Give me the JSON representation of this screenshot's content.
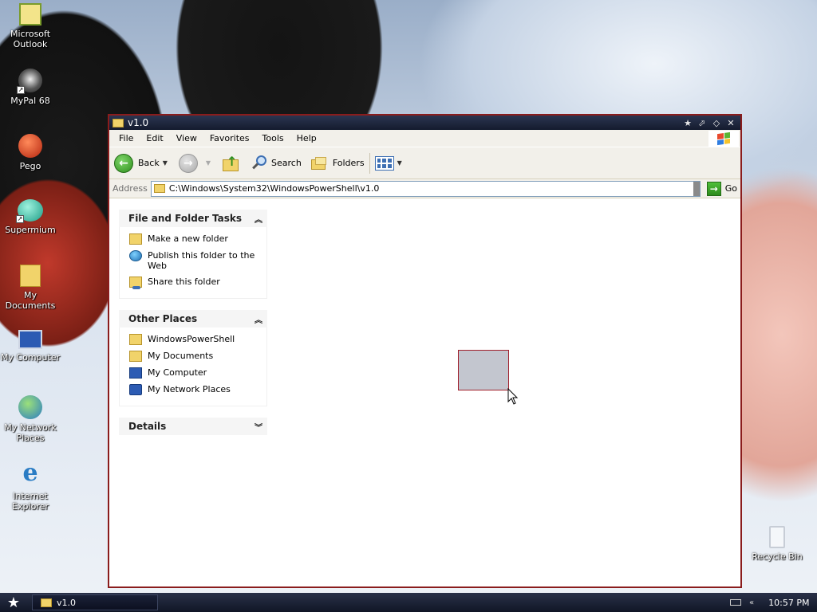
{
  "desktop": {
    "icons": [
      {
        "label": "Microsoft Outlook",
        "icon": "outlook-icon"
      },
      {
        "label": "MyPal 68",
        "icon": "mypal-icon"
      },
      {
        "label": "Pego",
        "icon": "pego-icon"
      },
      {
        "label": "Supermium",
        "icon": "supermium-icon"
      },
      {
        "label": "My Documents",
        "icon": "my-documents-icon"
      },
      {
        "label": "My Computer",
        "icon": "my-computer-icon"
      },
      {
        "label": "My Network Places",
        "icon": "network-places-icon"
      },
      {
        "label": "Internet Explorer",
        "icon": "internet-explorer-icon"
      },
      {
        "label": "Recycle Bin",
        "icon": "recycle-bin-icon"
      }
    ]
  },
  "window": {
    "title": "v1.0",
    "menu": [
      "File",
      "Edit",
      "View",
      "Favorites",
      "Tools",
      "Help"
    ],
    "toolbar": {
      "back": "Back",
      "search": "Search",
      "folders": "Folders"
    },
    "address": {
      "label": "Address",
      "value": "C:\\Windows\\System32\\WindowsPowerShell\\v1.0",
      "go": "Go"
    },
    "tasks_panel": {
      "title": "File and Folder Tasks",
      "items": [
        {
          "label": "Make a new folder",
          "icon": "new-folder-icon"
        },
        {
          "label": "Publish this folder to the Web",
          "icon": "publish-web-icon"
        },
        {
          "label": "Share this folder",
          "icon": "share-folder-icon"
        }
      ]
    },
    "other_places": {
      "title": "Other Places",
      "items": [
        {
          "label": "WindowsPowerShell",
          "icon": "folder-icon"
        },
        {
          "label": "My Documents",
          "icon": "my-documents-icon"
        },
        {
          "label": "My Computer",
          "icon": "my-computer-icon"
        },
        {
          "label": "My Network Places",
          "icon": "network-places-icon"
        }
      ]
    },
    "details": {
      "title": "Details"
    }
  },
  "taskbar": {
    "task_label": "v1.0",
    "clock": "10:57 PM"
  },
  "colors": {
    "window_border": "#8a1c1c",
    "titlebar": "#141b2e",
    "taskbar": "#101626",
    "selection_fill": "#c3c6cf",
    "selection_border": "#a01f2b"
  }
}
